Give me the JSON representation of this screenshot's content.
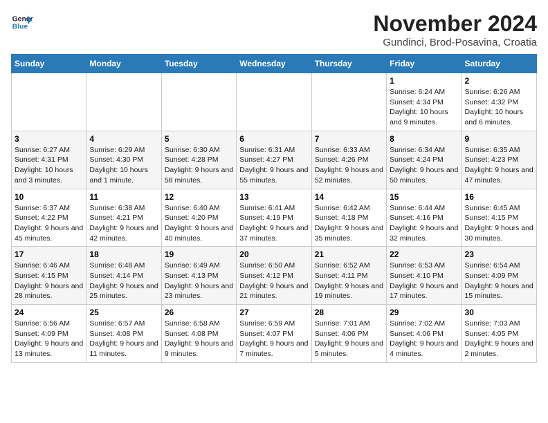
{
  "header": {
    "logo_line1": "General",
    "logo_line2": "Blue",
    "month": "November 2024",
    "location": "Gundinci, Brod-Posavina, Croatia"
  },
  "columns": [
    "Sunday",
    "Monday",
    "Tuesday",
    "Wednesday",
    "Thursday",
    "Friday",
    "Saturday"
  ],
  "weeks": [
    [
      {
        "day": "",
        "info": ""
      },
      {
        "day": "",
        "info": ""
      },
      {
        "day": "",
        "info": ""
      },
      {
        "day": "",
        "info": ""
      },
      {
        "day": "",
        "info": ""
      },
      {
        "day": "1",
        "info": "Sunrise: 6:24 AM\nSunset: 4:34 PM\nDaylight: 10 hours and 9 minutes."
      },
      {
        "day": "2",
        "info": "Sunrise: 6:26 AM\nSunset: 4:32 PM\nDaylight: 10 hours and 6 minutes."
      }
    ],
    [
      {
        "day": "3",
        "info": "Sunrise: 6:27 AM\nSunset: 4:31 PM\nDaylight: 10 hours and 3 minutes."
      },
      {
        "day": "4",
        "info": "Sunrise: 6:29 AM\nSunset: 4:30 PM\nDaylight: 10 hours and 1 minute."
      },
      {
        "day": "5",
        "info": "Sunrise: 6:30 AM\nSunset: 4:28 PM\nDaylight: 9 hours and 58 minutes."
      },
      {
        "day": "6",
        "info": "Sunrise: 6:31 AM\nSunset: 4:27 PM\nDaylight: 9 hours and 55 minutes."
      },
      {
        "day": "7",
        "info": "Sunrise: 6:33 AM\nSunset: 4:26 PM\nDaylight: 9 hours and 52 minutes."
      },
      {
        "day": "8",
        "info": "Sunrise: 6:34 AM\nSunset: 4:24 PM\nDaylight: 9 hours and 50 minutes."
      },
      {
        "day": "9",
        "info": "Sunrise: 6:35 AM\nSunset: 4:23 PM\nDaylight: 9 hours and 47 minutes."
      }
    ],
    [
      {
        "day": "10",
        "info": "Sunrise: 6:37 AM\nSunset: 4:22 PM\nDaylight: 9 hours and 45 minutes."
      },
      {
        "day": "11",
        "info": "Sunrise: 6:38 AM\nSunset: 4:21 PM\nDaylight: 9 hours and 42 minutes."
      },
      {
        "day": "12",
        "info": "Sunrise: 6:40 AM\nSunset: 4:20 PM\nDaylight: 9 hours and 40 minutes."
      },
      {
        "day": "13",
        "info": "Sunrise: 6:41 AM\nSunset: 4:19 PM\nDaylight: 9 hours and 37 minutes."
      },
      {
        "day": "14",
        "info": "Sunrise: 6:42 AM\nSunset: 4:18 PM\nDaylight: 9 hours and 35 minutes."
      },
      {
        "day": "15",
        "info": "Sunrise: 6:44 AM\nSunset: 4:16 PM\nDaylight: 9 hours and 32 minutes."
      },
      {
        "day": "16",
        "info": "Sunrise: 6:45 AM\nSunset: 4:15 PM\nDaylight: 9 hours and 30 minutes."
      }
    ],
    [
      {
        "day": "17",
        "info": "Sunrise: 6:46 AM\nSunset: 4:15 PM\nDaylight: 9 hours and 28 minutes."
      },
      {
        "day": "18",
        "info": "Sunrise: 6:48 AM\nSunset: 4:14 PM\nDaylight: 9 hours and 25 minutes."
      },
      {
        "day": "19",
        "info": "Sunrise: 6:49 AM\nSunset: 4:13 PM\nDaylight: 9 hours and 23 minutes."
      },
      {
        "day": "20",
        "info": "Sunrise: 6:50 AM\nSunset: 4:12 PM\nDaylight: 9 hours and 21 minutes."
      },
      {
        "day": "21",
        "info": "Sunrise: 6:52 AM\nSunset: 4:11 PM\nDaylight: 9 hours and 19 minutes."
      },
      {
        "day": "22",
        "info": "Sunrise: 6:53 AM\nSunset: 4:10 PM\nDaylight: 9 hours and 17 minutes."
      },
      {
        "day": "23",
        "info": "Sunrise: 6:54 AM\nSunset: 4:09 PM\nDaylight: 9 hours and 15 minutes."
      }
    ],
    [
      {
        "day": "24",
        "info": "Sunrise: 6:56 AM\nSunset: 4:09 PM\nDaylight: 9 hours and 13 minutes."
      },
      {
        "day": "25",
        "info": "Sunrise: 6:57 AM\nSunset: 4:08 PM\nDaylight: 9 hours and 11 minutes."
      },
      {
        "day": "26",
        "info": "Sunrise: 6:58 AM\nSunset: 4:08 PM\nDaylight: 9 hours and 9 minutes."
      },
      {
        "day": "27",
        "info": "Sunrise: 6:59 AM\nSunset: 4:07 PM\nDaylight: 9 hours and 7 minutes."
      },
      {
        "day": "28",
        "info": "Sunrise: 7:01 AM\nSunset: 4:06 PM\nDaylight: 9 hours and 5 minutes."
      },
      {
        "day": "29",
        "info": "Sunrise: 7:02 AM\nSunset: 4:06 PM\nDaylight: 9 hours and 4 minutes."
      },
      {
        "day": "30",
        "info": "Sunrise: 7:03 AM\nSunset: 4:05 PM\nDaylight: 9 hours and 2 minutes."
      }
    ]
  ]
}
